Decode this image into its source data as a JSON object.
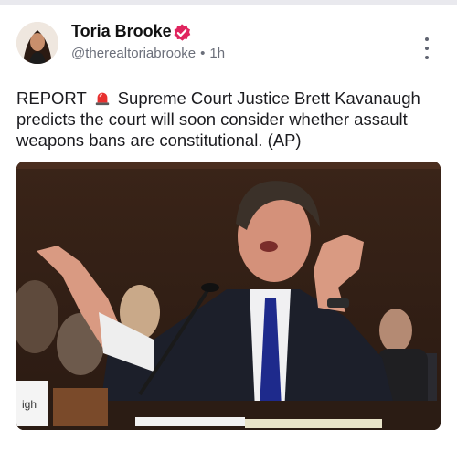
{
  "post": {
    "author": {
      "display_name": "Toria Brooke",
      "handle": "@therealtoriabrooke",
      "time_ago": "1h",
      "verified": true,
      "avatar": "profile-photo"
    },
    "menu_icon": "more-vertical-icon",
    "text_before_emoji": "REPORT",
    "emoji": "rotating-light-emoji",
    "text_after_emoji": "Supreme Court Justice Brett Kavanaugh predicts the court will soon consider whether assault weapons bans are constitutional. (AP)",
    "media": {
      "type": "photo",
      "sign_fragment": "igh"
    }
  },
  "colors": {
    "verified_badge": "#e0245e",
    "muted_text": "#6b6f7a",
    "body_text": "#1b1b1f"
  }
}
